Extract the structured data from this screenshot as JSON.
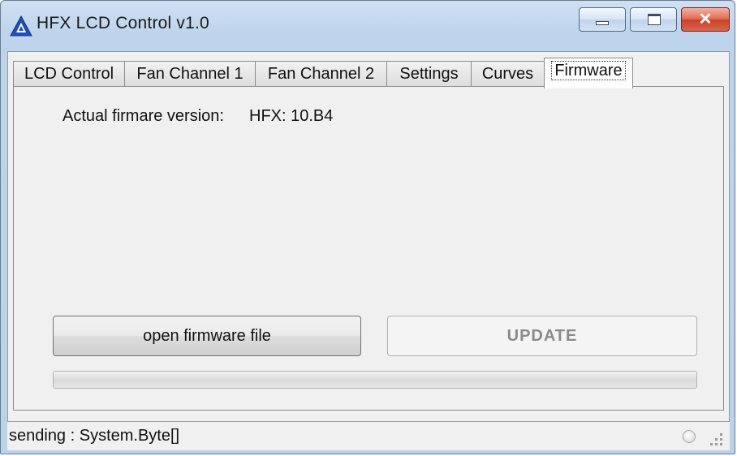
{
  "window": {
    "title": "HFX LCD Control v1.0",
    "icon": "triangle-logo-icon",
    "controls": {
      "minimize": "minimize-icon",
      "maximize": "maximize-icon",
      "close": "close-icon"
    }
  },
  "tabs": [
    {
      "label": "LCD Control"
    },
    {
      "label": "Fan Channel 1"
    },
    {
      "label": "Fan Channel 2"
    },
    {
      "label": "Settings"
    },
    {
      "label": "Curves"
    },
    {
      "label": "Firmware",
      "active": true
    }
  ],
  "firmware": {
    "version_label": "Actual firmare version:",
    "version_value": "HFX: 10.B4",
    "open_button": "open firmware file",
    "update_button": "UPDATE",
    "progress": 0
  },
  "statusbar": {
    "text": "sending : System.Byte[]"
  },
  "colors": {
    "titlebar": "#bed4ec",
    "close_button": "#c9412a",
    "panel": "#f0f0f0"
  }
}
